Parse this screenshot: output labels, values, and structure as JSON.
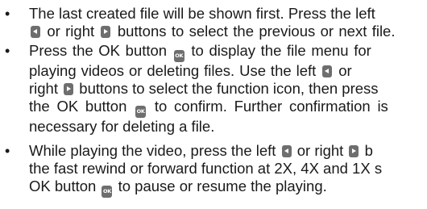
{
  "bullet_symbol": "•",
  "icons": {
    "left": "left-arrow-button-icon",
    "right": "right-arrow-button-icon",
    "ok": "ok-button-icon",
    "ok_text": "OK"
  },
  "items": [
    {
      "l1a": "The last created file will be shown first. Press the left",
      "l2b": "or right",
      "l2c": "buttons to select the previous or next file."
    },
    {
      "l1a": "Press the OK button",
      "l1b": "to display the file menu for",
      "l2a": "playing videos or deleting files. Use the left",
      "l2b": "or",
      "l3a": "right",
      "l3b": "buttons to select the function icon, then press",
      "l4a": "the OK button",
      "l4b": "to confirm. Further confirmation is",
      "l5a": "necessary for deleting a file."
    },
    {
      "l1a": "While playing the video, press the left",
      "l1b": "or right",
      "l1c": "b",
      "l2a": "the fast rewind or forward function at 2X, 4X and 1X s",
      "l3a": "OK button",
      "l3b": "to pause or resume the playing."
    }
  ]
}
